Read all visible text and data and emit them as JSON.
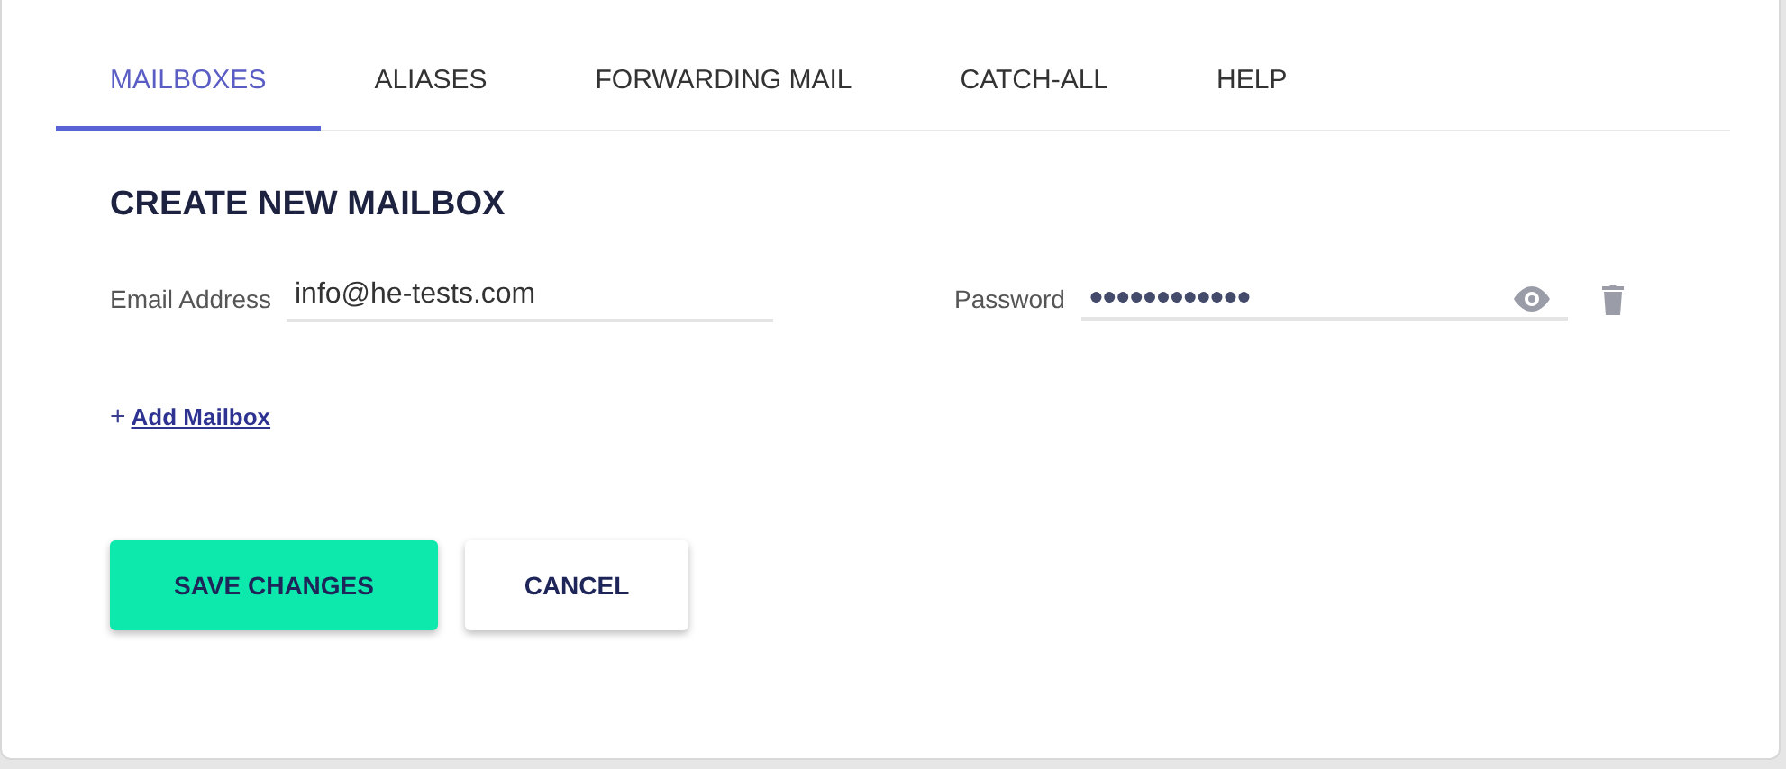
{
  "tabs": [
    {
      "label": "MAILBOXES",
      "selected": true
    },
    {
      "label": "ALIASES",
      "selected": false
    },
    {
      "label": "FORWARDING MAIL",
      "selected": false
    },
    {
      "label": "CATCH-ALL",
      "selected": false
    },
    {
      "label": "HELP",
      "selected": false
    }
  ],
  "heading": "CREATE NEW MAILBOX",
  "email": {
    "label": "Email Address",
    "value": "info@he-tests.com"
  },
  "password": {
    "label": "Password",
    "value": "●●●●●●●●●●●●"
  },
  "add_link": {
    "icon": "+",
    "label": "Add Mailbox"
  },
  "buttons": [
    {
      "label": "SAVE CHANGES",
      "kind": "primary"
    },
    {
      "label": "CANCEL",
      "kind": "secondary"
    }
  ]
}
